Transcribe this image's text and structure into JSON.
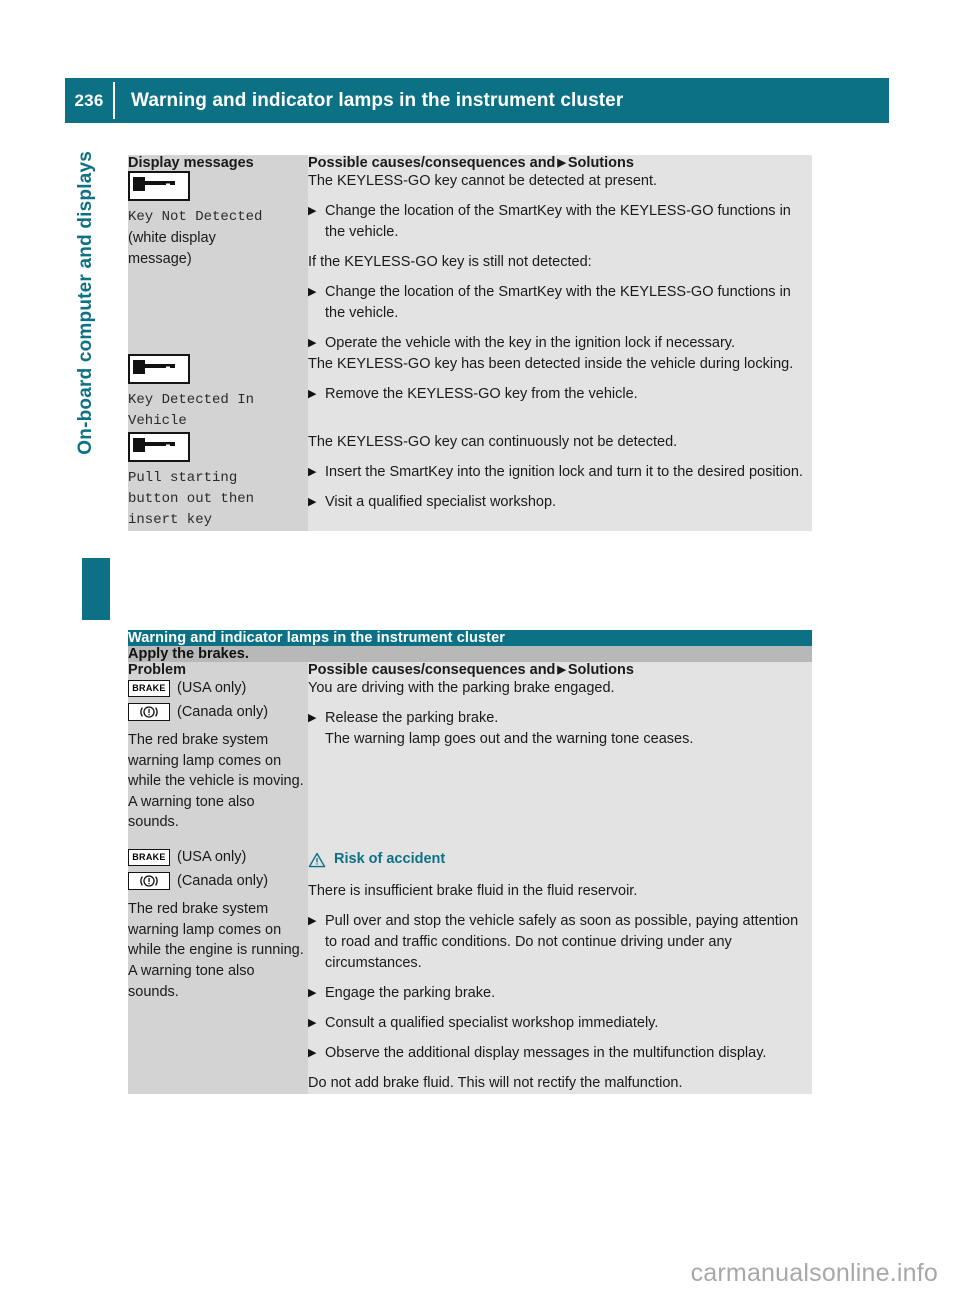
{
  "header": {
    "page_number": "236",
    "title": "Warning and indicator lamps in the instrument cluster"
  },
  "chapter_tab": {
    "label": "On-board computer and displays",
    "color": "#0c7185"
  },
  "colors": {
    "teal": "#0c7185",
    "band_gray": "#b8b8b8",
    "cell_left_gray": "#d3d3d3",
    "cell_right_gray": "#e3e3e3"
  },
  "table_one": {
    "headers": {
      "left": "Display messages",
      "right_prefix": "Possible causes/consequences and",
      "right_suffix": "Solutions"
    },
    "rows": [
      {
        "icon": "keyless-go-key-icon",
        "message": "Key Not Detected",
        "note": "(white display\nmessage)",
        "content": [
          {
            "type": "para",
            "text": "The KEYLESS-GO key cannot be detected at present."
          },
          {
            "type": "bullet",
            "text": "Change the location of the SmartKey with the KEYLESS-GO functions in the vehicle."
          },
          {
            "type": "para",
            "text": "If the KEYLESS-GO key is still not detected:"
          },
          {
            "type": "bullet",
            "text": "Change the location of the SmartKey with the KEYLESS-GO functions in the vehicle."
          },
          {
            "type": "bullet",
            "text": "Operate the vehicle with the key in the ignition lock if necessary."
          }
        ]
      },
      {
        "icon": "keyless-go-key-icon",
        "message": "Key Detected In\nVehicle",
        "note": "",
        "content": [
          {
            "type": "para",
            "text": "The KEYLESS-GO key has been detected inside the vehicle during locking."
          },
          {
            "type": "bullet",
            "text": "Remove the KEYLESS-GO key from the vehicle."
          }
        ]
      },
      {
        "icon": "keyless-go-key-icon",
        "message": "Pull starting\nbutton out then\ninsert key",
        "note": "",
        "content": [
          {
            "type": "para",
            "text": "The KEYLESS-GO key can continuously not be detected."
          },
          {
            "type": "bullet",
            "text": "Insert the SmartKey into the ignition lock and turn it to the desired position."
          },
          {
            "type": "bullet",
            "text": "Visit a qualified specialist workshop."
          }
        ]
      }
    ]
  },
  "table_two": {
    "section_title": "Warning and indicator lamps in the instrument cluster",
    "subsection_title": "Apply the brakes.",
    "headers": {
      "left": "Problem",
      "right_prefix": "Possible causes/consequences and",
      "right_suffix": "Solutions"
    },
    "rows": [
      {
        "icon_usa_label": "BRAKE",
        "icon_usa_note": "(USA only)",
        "icon_canada_note": "(Canada only)",
        "body": "The red brake system warning lamp comes on while the vehicle is moving. A warning tone also sounds.",
        "content": [
          {
            "type": "para",
            "text": "You are driving with the parking brake engaged."
          },
          {
            "type": "bullet",
            "text": "Release the parking brake.",
            "sub": "The warning lamp goes out and the warning tone ceases."
          }
        ]
      },
      {
        "icon_usa_label": "BRAKE",
        "icon_usa_note": "(USA only)",
        "icon_canada_note": "(Canada only)",
        "body": "The red brake system warning lamp comes on while the engine is running. A warning tone also sounds.",
        "warning_title": "Risk of accident",
        "content": [
          {
            "type": "para",
            "text": "There is insufficient brake fluid in the fluid reservoir."
          },
          {
            "type": "bullet",
            "text": "Pull over and stop the vehicle safely as soon as possible, paying attention to road and traffic conditions. Do not continue driving under any circumstances."
          },
          {
            "type": "bullet",
            "text": "Engage the parking brake."
          },
          {
            "type": "bullet",
            "text": "Consult a qualified specialist workshop immediately."
          },
          {
            "type": "bullet",
            "text": "Observe the additional display messages in the multifunction display."
          },
          {
            "type": "para",
            "text": "Do not add brake fluid. This will not rectify the malfunction."
          }
        ]
      }
    ]
  },
  "watermark": "carmanualsonline.info"
}
